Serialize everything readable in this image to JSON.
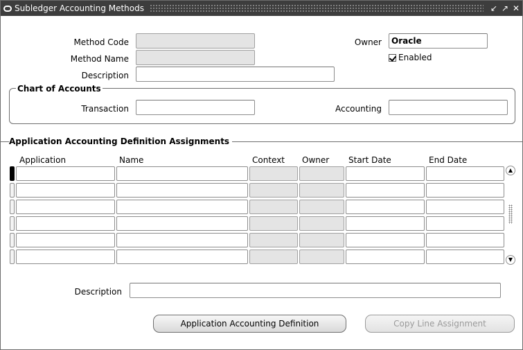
{
  "window": {
    "title": "Subledger Accounting Methods",
    "controls": [
      "minimize",
      "maximize",
      "close"
    ]
  },
  "header_fields": {
    "method_code_label": "Method Code",
    "method_code_value": "",
    "method_name_label": "Method Name",
    "method_name_value": "",
    "description_label": "Description",
    "description_value": "",
    "owner_label": "Owner",
    "owner_value": "Oracle",
    "enabled_label": "Enabled",
    "enabled_checked": true
  },
  "chart_of_accounts": {
    "title": "Chart of Accounts",
    "transaction_label": "Transaction",
    "transaction_value": "",
    "accounting_label": "Accounting",
    "accounting_value": ""
  },
  "assignments": {
    "title": "Application Accounting Definition Assignments",
    "columns": [
      "Application",
      "Name",
      "Context",
      "Owner",
      "Start Date",
      "End Date"
    ],
    "rows": [
      [
        "",
        "",
        "",
        "",
        "",
        ""
      ],
      [
        "",
        "",
        "",
        "",
        "",
        ""
      ],
      [
        "",
        "",
        "",
        "",
        "",
        ""
      ],
      [
        "",
        "",
        "",
        "",
        "",
        ""
      ],
      [
        "",
        "",
        "",
        "",
        "",
        ""
      ],
      [
        "",
        "",
        "",
        "",
        "",
        ""
      ]
    ],
    "description_label": "Description",
    "description_value": ""
  },
  "buttons": {
    "app_accounting_definition": "Application Accounting Definition",
    "copy_line_assignment": "Copy Line Assignment"
  },
  "colors": {
    "titlebar": "#3d3d3d",
    "readonly_field": "#e4e4e4",
    "disabled_text": "#9a9a9a"
  }
}
